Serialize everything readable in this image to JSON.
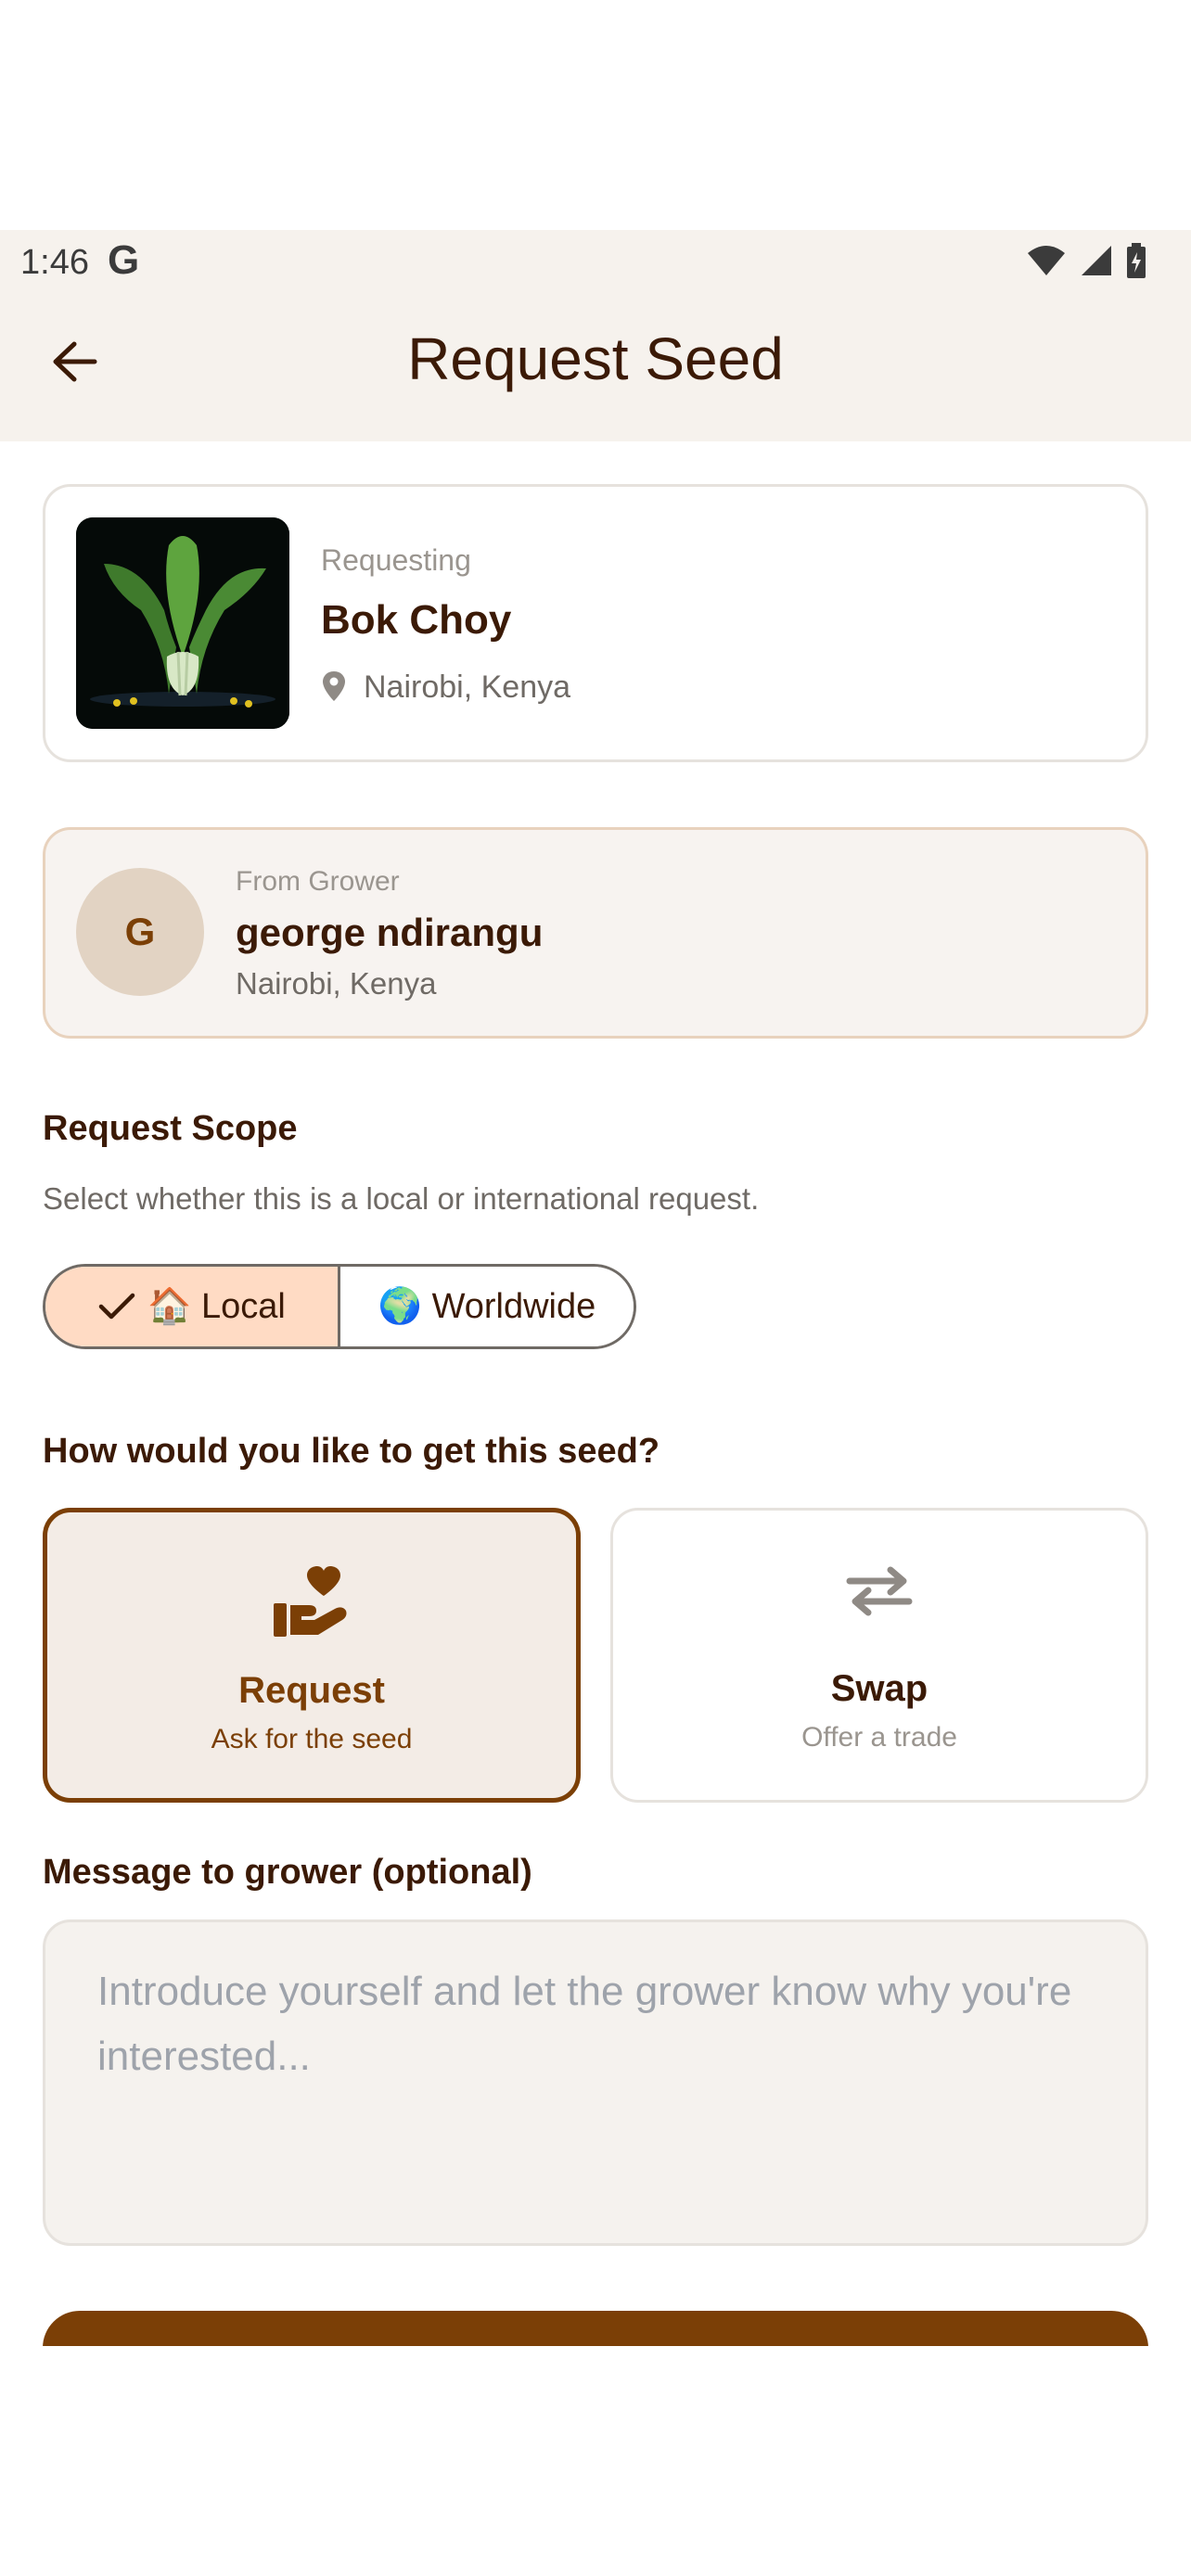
{
  "status_bar": {
    "time": "1:46",
    "g_label": "G"
  },
  "app_bar": {
    "title": "Request Seed"
  },
  "seed": {
    "label": "Requesting",
    "name": "Bok Choy",
    "location": "Nairobi, Kenya"
  },
  "grower": {
    "from_label": "From Grower",
    "initial": "G",
    "name": "george ndirangu",
    "location": "Nairobi, Kenya"
  },
  "scope": {
    "title": "Request Scope",
    "description": "Select whether this is a local or international request.",
    "options": [
      {
        "label": "🏠 Local",
        "selected": true
      },
      {
        "label": "🌍 Worldwide",
        "selected": false
      }
    ]
  },
  "method": {
    "title": "How would you like to get this seed?",
    "options": [
      {
        "title": "Request",
        "subtitle": "Ask for the seed",
        "icon": "hand-heart-icon",
        "selected": true
      },
      {
        "title": "Swap",
        "subtitle": "Offer a trade",
        "icon": "swap-arrows-icon",
        "selected": false
      }
    ]
  },
  "message": {
    "title": "Message to grower (optional)",
    "placeholder": "Introduce yourself and let the grower know why you're interested...",
    "value": ""
  },
  "colors": {
    "accent": "#7b3f06",
    "text": "#3b1a06",
    "selected_segment": "#ffdbc4",
    "app_bar": "#f6f2ed"
  }
}
